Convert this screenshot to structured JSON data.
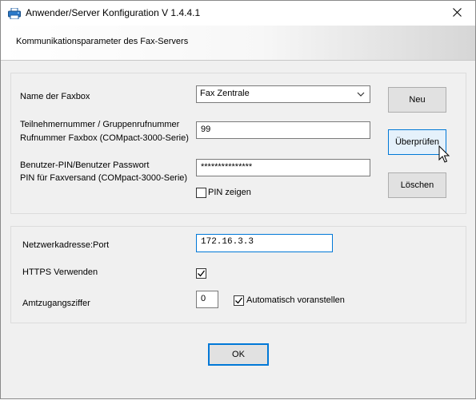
{
  "window": {
    "title": "Anwender/Server Konfiguration V 1.4.4.1",
    "icons": {
      "app": "printer-fax-icon",
      "close": "close-icon"
    }
  },
  "header": {
    "text": "Kommunikationsparameter des Fax-Servers"
  },
  "faxbox": {
    "name_label": "Name der Faxbox",
    "name_selected": "Fax Zentrale",
    "number_label_1": "Teilnehmernummer / Gruppenrufnummer",
    "number_label_2": "Rufnummer Faxbox (COMpact-3000-Serie)",
    "number_value": "99",
    "pin_label_1": "Benutzer-PIN/Benutzer Passwort",
    "pin_label_2": "PIN für Faxversand (COMpact-3000-Serie)",
    "pin_value": "***************",
    "show_pin_label": "PIN zeigen",
    "show_pin_checked": false
  },
  "buttons": {
    "new": "Neu",
    "check": "Überprüfen",
    "delete": "Löschen",
    "ok": "OK"
  },
  "network": {
    "address_label": "Netzwerkadresse:Port",
    "address_value": "172.16.3.3",
    "https_label": "HTTPS Verwenden",
    "https_checked": true,
    "trunk_label": "Amtzugangsziffer",
    "trunk_value": "0",
    "auto_prefix_label": "Automatisch voranstellen",
    "auto_prefix_checked": true
  },
  "colors": {
    "accent": "#0078d7",
    "dialog_bg": "#f0f0f0",
    "button_bg": "#e1e1e1"
  }
}
